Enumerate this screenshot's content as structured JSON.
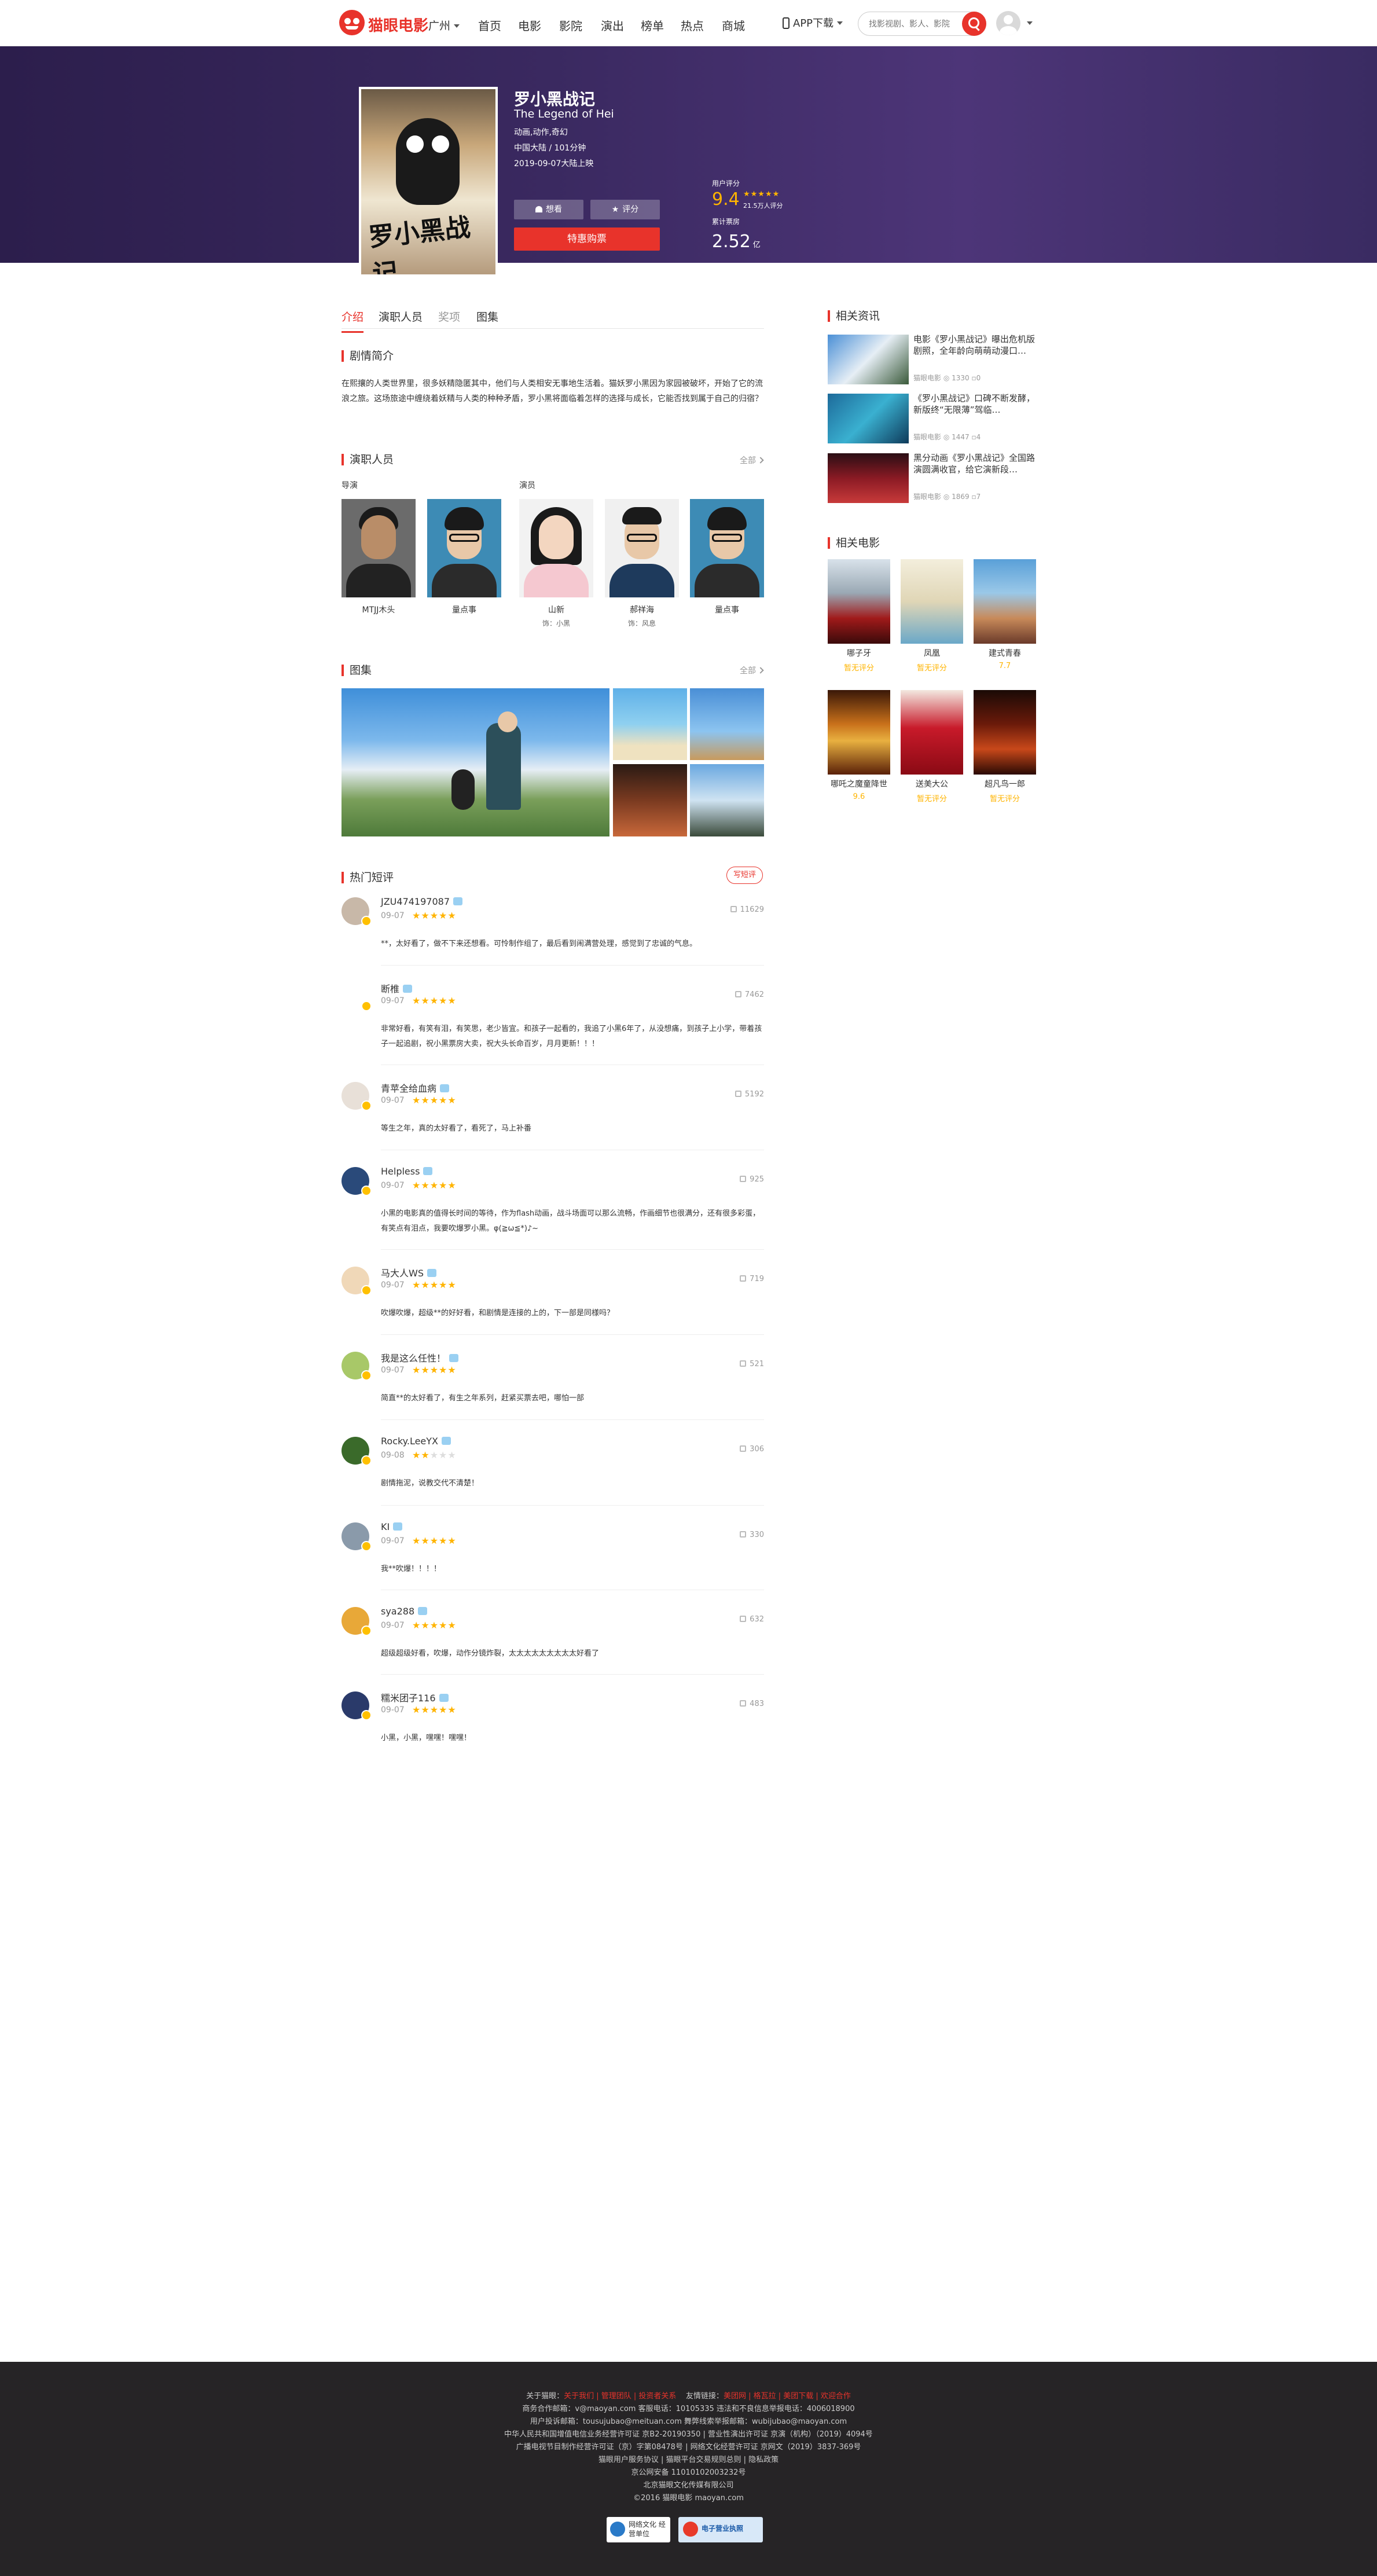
{
  "header": {
    "logo_text": "猫眼电影",
    "city": "广州",
    "nav": [
      "首页",
      "电影",
      "影院",
      "演出",
      "榜单",
      "热点",
      "商城"
    ],
    "app_download": "APP下载",
    "search_placeholder": "找影视剧、影人、影院"
  },
  "movie": {
    "title": "罗小黑战记",
    "title_en": "The Legend of Hei",
    "genre": "动画,动作,奇幻",
    "region_duration": "中国大陆 / 101分钟",
    "release": "2019-09-07大陆上映",
    "wish_label": "想看",
    "rate_label": "评分",
    "buy_label": "特惠购票",
    "user_score_label": "用户评分",
    "score": "9.4",
    "rating_count": "21.5万人评分",
    "box_label": "累计票房",
    "box_value": "2.52",
    "box_unit": "亿"
  },
  "tabs": [
    "介绍",
    "演职人员",
    "奖项",
    "图集"
  ],
  "synopsis": {
    "title": "剧情简介",
    "text": "在熙攘的人类世界里，很多妖精隐匿其中，他们与人类相安无事地生活着。猫妖罗小黑因为家园被破坏，开始了它的流浪之旅。这场旅途中缠绕着妖精与人类的种种矛盾，罗小黑将面临着怎样的选择与成长，它能否找到属于自己的归宿？"
  },
  "cast": {
    "title": "演职人员",
    "all": "全部",
    "director_label": "导演",
    "actor_label": "演员",
    "people": [
      {
        "name": "MTJJ木头",
        "role": ""
      },
      {
        "name": "量点事",
        "role": ""
      },
      {
        "name": "山新",
        "role": "饰：小黑"
      },
      {
        "name": "郝祥海",
        "role": "饰：风息"
      },
      {
        "name": "量点事",
        "role": ""
      }
    ]
  },
  "gallery": {
    "title": "图集",
    "all": "全部"
  },
  "comments": {
    "title": "热门短评",
    "write": "写短评",
    "items": [
      {
        "nick": "JZU474197087",
        "date": "09-07",
        "stars": 5,
        "likes": "11629",
        "text": "**，太好看了，做不下来还想看。可怜制作组了，最后看到闹满营处理，感觉到了忠诚的气息。"
      },
      {
        "nick": "断椎",
        "date": "09-07",
        "stars": 5,
        "likes": "7462",
        "text": "非常好看，有笑有泪，有笑思，老少皆宜。和孩子一起看的，我追了小黑6年了，从没想痛，到孩子上小学，带着孩子一起追剧，祝小黑票房大卖，祝大头长命百岁，月月更新！！！"
      },
      {
        "nick": "青苹全给血病",
        "date": "09-07",
        "stars": 5,
        "likes": "5192",
        "text": "等生之年，真的太好看了，看死了，马上补番"
      },
      {
        "nick": "Helpless",
        "date": "09-07",
        "stars": 5,
        "likes": "925",
        "text": "小黑的电影真的值得长时间的等待，作为flash动画，战斗场面可以那么流畅，作画细节也很满分，还有很多彩蛋，有笑点有泪点，我要吹爆罗小黑。φ(≧ω≦*)♪~"
      },
      {
        "nick": "马大人WS",
        "date": "09-07",
        "stars": 5,
        "likes": "719",
        "text": "吹爆吹爆，超级**的好好看，和剧情是连接的上的，下一部是同様吗？"
      },
      {
        "nick": "我是这么任性！",
        "date": "09-07",
        "stars": 5,
        "likes": "521",
        "text": "简直**的太好看了，有生之年系列，赶紧买票去吧，哪怕一部"
      },
      {
        "nick": "Rocky.LeeYX",
        "date": "09-08",
        "stars": 2,
        "likes": "306",
        "text": "剧情拖泥，说教交代不清楚！"
      },
      {
        "nick": "KI",
        "date": "09-07",
        "stars": 5,
        "likes": "330",
        "text": "我**吹爆！！！！"
      },
      {
        "nick": "sya288",
        "date": "09-07",
        "stars": 5,
        "likes": "632",
        "text": "超级超级好看，吹爆，动作分镜炸裂，太太太太太太太太太好看了"
      },
      {
        "nick": "糯米团子116",
        "date": "09-07",
        "stars": 5,
        "likes": "483",
        "text": "小黑，小黑，嘿嘿！嘿嘿！"
      }
    ]
  },
  "news": {
    "title": "相关资讯",
    "items": [
      {
        "title": "电影《罗小黑战记》曝出危机版剧照，全年龄向萌萌动漫口…",
        "source": "猫眼电影",
        "views": "1330",
        "comments": "0"
      },
      {
        "title": "《罗小黑战记》口碑不断发酵，新版终“无限薄”驾临…",
        "source": "猫眼电影",
        "views": "1447",
        "comments": "4"
      },
      {
        "title": "黑分动画《罗小黑战记》全国路演圆满收官，给它演新段…",
        "source": "猫眼电影",
        "views": "1869",
        "comments": "7"
      }
    ]
  },
  "related": {
    "title": "相关电影",
    "items": [
      {
        "name": "哪子牙",
        "score": "暂无评分"
      },
      {
        "name": "凤凰",
        "score": "暂无评分"
      },
      {
        "name": "建式青春",
        "score": "7.7"
      },
      {
        "name": "哪吒之魔童降世",
        "score": "9.6"
      },
      {
        "name": "送美大公",
        "score": "暂无评分"
      },
      {
        "name": "超凡鸟一郎",
        "score": "暂无评分"
      }
    ]
  },
  "footer": {
    "line1_label": "关于猫眼：",
    "line1_links": "关于我们 | 管理团队 | 投资者关系",
    "line1_friend": "友情链接：",
    "line1_friend_links": "美团网 | 格瓦拉 | 美团下载 | 欢迎合作",
    "line2": "商务合作邮箱：v@maoyan.com 客服电话：10105335 违法和不良信息举报电话：4006018900",
    "line3": "用户投诉邮箱：tousujubao@meituan.com 舞弊线索举报邮箱：wubijubao@maoyan.com",
    "line4": "中华人民共和国增值电信业务经营许可证 京B2-20190350 | 营业性演出许可证 京演（机构）（2019）4094号",
    "line5": "广播电视节目制作经营许可证（京）字第08478号 | 网络文化经营许可证 京网文（2019）3837-369号",
    "line6": "猫眼用户服务协议 | 猫眼平台交易规则总则 | 隐私政策",
    "line7": "京公网安备 11010102003232号",
    "line8": "北京猫眼文化传媒有限公司",
    "line9": "©2016 猫眼电影 maoyan.com",
    "badge1": "网络文化 经营单位",
    "badge2": "电子营业执照"
  }
}
